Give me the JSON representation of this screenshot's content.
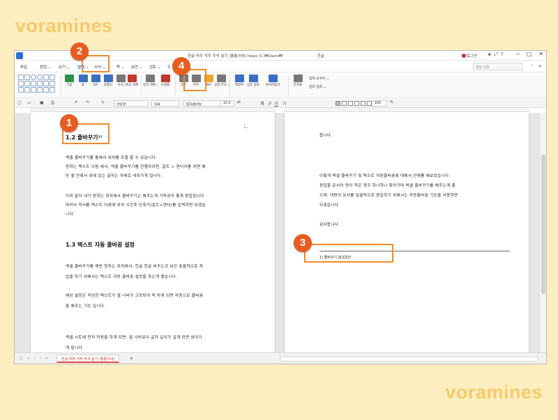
{
  "watermark": "voramines",
  "window": {
    "title": "한글 미주 각주 주석 달기 (통통이네).hwpx [C:₩Users₩",
    "app_name": "- 한글",
    "login_label": "로그인"
  },
  "menubar": {
    "items": [
      {
        "label": "파일",
        "active": false
      },
      {
        "label": "편집 ⌄",
        "active": false
      },
      {
        "label": "보기 ⌄",
        "active": false
      },
      {
        "label": "입력 ⌄",
        "active": true
      },
      {
        "label": "서식 ⌄",
        "active": false
      },
      {
        "label": "쪽 ⌄",
        "active": false
      },
      {
        "label": "보안 ⌄",
        "active": false
      },
      {
        "label": "검토 ⌄",
        "active": false
      },
      {
        "label": "도",
        "active": false
      }
    ],
    "search_placeholder": "찾을 내용"
  },
  "ribbon": {
    "tools": [
      {
        "label": "그림",
        "color": "#2f8f4a"
      },
      {
        "label": "표",
        "color": "#3b6fc4"
      },
      {
        "label": "차트",
        "color": "#3b6fc4"
      },
      {
        "label": "글맵시",
        "color": "#3b6fc4"
      },
      {
        "label": "수식",
        "color": "#555555"
      },
      {
        "label": "OLE 개체",
        "color": "#c0392b"
      },
      {
        "label": "양식 개체 ⌄",
        "color": "#555555"
      },
      {
        "label": "누름틀",
        "color": "#c0392b"
      },
      {
        "label": "각주",
        "color": "#555555"
      },
      {
        "label": "미주",
        "color": "#555555"
      },
      {
        "label": "메모",
        "color": "#e8a92a"
      },
      {
        "label": "교정 부호 ⌄",
        "color": "#555555"
      },
      {
        "label": "책갈피",
        "color": "#3b6fc4"
      },
      {
        "label": "상호 참조",
        "color": "#3b6fc4"
      },
      {
        "label": "하이퍼링크",
        "color": "#3b6fc4"
      },
      {
        "label": "문자표",
        "color": "#555555"
      }
    ],
    "input_tool_label": "입력 도우미 ⌄",
    "hanja_label": "한자 입력 ⌄"
  },
  "formatbar": {
    "style": "바탕글",
    "lang": "대표",
    "font": "함초롬바탕",
    "size": "10.0",
    "size_unit": "pt",
    "zoom": "160",
    "zoom_unit": "%"
  },
  "document": {
    "left": {
      "heading1": "1.2 줄바꾸기¹⁾",
      "p1_l1": "엑셀 줄바꾸기를 통해서 위치를 조절 할 수 있습니다.",
      "p1_l2": "원하는 텍스트 다음 에서, 엑셀 줄바꾸기를 진행하려면, 알트 + 엔터키를 치면 해",
      "p1_l3": "당 셀 안에서 위에 있는 글자는 아래로 내려가게 됩니다.",
      "p2_l1": "이와 같이 내가 원하는 위치에서 줄바꾸기는 해주는게 가독성이 좋게 편집됩니다.",
      "p2_l2": "따라서 적서를 텍스트 다음에 위치 시킨후 단축키(알트+엔터)를 입력하면 되겠습",
      "p2_l3": "니다.",
      "heading2": "1.3 텍스트 자동 줄바꿈 설정",
      "p3_l1": "엑셀 줄바꾸기를 때번 원하는 위치에서, 한글 한글 바꾸는것 보단 효율적으로 작",
      "p3_l2": "업을 하기 위해서는 텍스트 자동 줄바꿈 설정을 하는게 좋습니다.",
      "p4_l1": "해당 설정은 작성한 텍스트가 셀 너비가 고정되어 딱 차게 되면 자동으로 줄바꿈",
      "p4_l2": "을 해주는 기능 입니다.",
      "p5_l1": "엑셀 시트에 먼저 작성을 하게 되면, 셀 너비보다 글자 길이가 길게 되면 넘어가",
      "p5_l2": "게 됩니다."
    },
    "right": {
      "r1": "줍니다.",
      "r2": "이렇게 엑셀 줄바꾸기 및 텍스트 자동줄바꿈에 대해서 안해를 해보았습니다.",
      "r3_l1": "편집할 문서의 양이 적은 경우 하나하나 찾아가며 엑셀 줄바꾸기를 해주는게 좋",
      "r3_l2": "으며, 대량의 문서를 일괄적으로 편집하기 위해서는 자동줄바꿈 기능을 사용하면",
      "r3_l3": "되겠습니다.",
      "r4": "감사합니다.",
      "footnote": "1) 줄바꾸기 참고문헌"
    }
  },
  "statusbar": {
    "tab_label": "한글 미주 각주 주석 달기 (통통이네)"
  },
  "annotations": [
    "1",
    "2",
    "3",
    "4"
  ]
}
